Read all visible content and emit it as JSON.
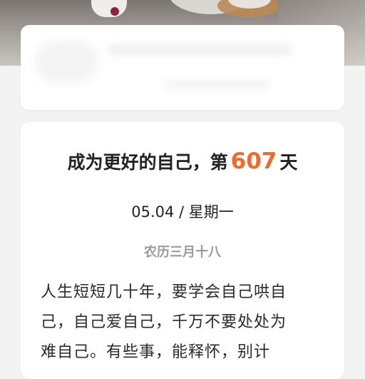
{
  "header_card": {},
  "quote_card": {
    "title_prefix": "成为更好的自己，第",
    "day_count": "607",
    "title_suffix": "天",
    "date": "05.04 / 星期一",
    "lunar_date": "农历三月十八",
    "quote_lines": [
      "人生短短几十年，要学会自己哄自",
      "己，自己爱自己，千万不要处处为",
      "难自己。有些事，能释怀，别计"
    ]
  },
  "colors": {
    "accent": "#f26a2a",
    "background": "#f3f3f3",
    "card": "#ffffff"
  }
}
